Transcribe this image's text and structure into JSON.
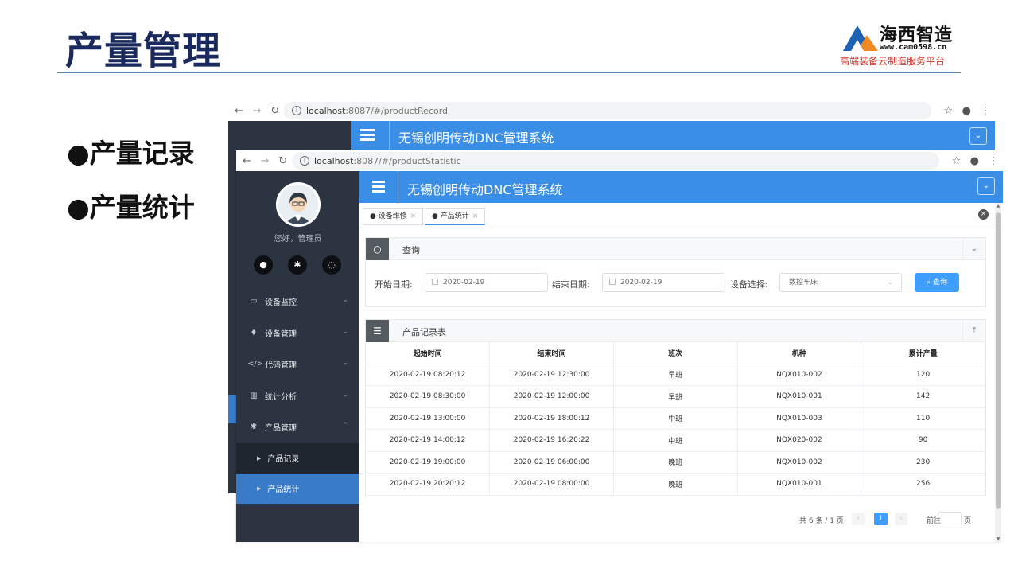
{
  "slide": {
    "title": "产量管理",
    "bullets": [
      "●产量记录",
      "●产量统计"
    ]
  },
  "logo": {
    "brand": "海西智造",
    "url": "www.cam0598.cn",
    "tagline": "高端装备云制造服务平台"
  },
  "back_browser": {
    "url_host": "localhost",
    "url_rest": ":8087/#/productRecord",
    "system_title": "无锡创明传动DNC管理系统"
  },
  "front_browser": {
    "url_host": "localhost",
    "url_rest": ":8087/#/productStatistic",
    "system_title": "无锡创明传动DNC管理系统",
    "sidebar": {
      "greeting": "您好，管理员",
      "menu": [
        {
          "label": "设备监控",
          "icon": "monitor-icon"
        },
        {
          "label": "设备管理",
          "icon": "location-pin-icon"
        },
        {
          "label": "代码管理",
          "icon": "code-icon"
        },
        {
          "label": "统计分析",
          "icon": "bar-chart-icon"
        },
        {
          "label": "产品管理",
          "icon": "gear-icon"
        }
      ],
      "sub_menu": [
        "产品记录",
        "产品统计"
      ]
    },
    "tabs": [
      "● 设备维修",
      "● 产品统计"
    ],
    "query": {
      "title": "查询",
      "start_label": "开始日期:",
      "start_value": "2020-02-19",
      "end_label": "结束日期:",
      "end_value": "2020-02-19",
      "device_label": "设备选择:",
      "device_value": "数控车床",
      "button": "查询"
    },
    "table": {
      "title": "产品记录表",
      "columns": [
        "起始时间",
        "结束时间",
        "班次",
        "机种",
        "累计产量"
      ],
      "rows": [
        [
          "2020-02-19 08:20:12",
          "2020-02-19 12:30:00",
          "早班",
          "NQX010-002",
          "120"
        ],
        [
          "2020-02-19 08:30:00",
          "2020-02-19 12:00:00",
          "早班",
          "NQX010-001",
          "142"
        ],
        [
          "2020-02-19 13:00:00",
          "2020-02-19 18:00:12",
          "中班",
          "NQX010-003",
          "110"
        ],
        [
          "2020-02-19 14:00:12",
          "2020-02-19 16:20:22",
          "中班",
          "NQX020-002",
          "90"
        ],
        [
          "2020-02-19 19:00:00",
          "2020-02-19 06:00:00",
          "晚班",
          "NQX010-002",
          "230"
        ],
        [
          "2020-02-19 20:20:12",
          "2020-02-19 08:00:00",
          "晚班",
          "NQX010-001",
          "256"
        ]
      ]
    },
    "pager": {
      "total": "共 6 条 / 1 页",
      "current": "1",
      "goto": "前往",
      "page": "页"
    }
  }
}
